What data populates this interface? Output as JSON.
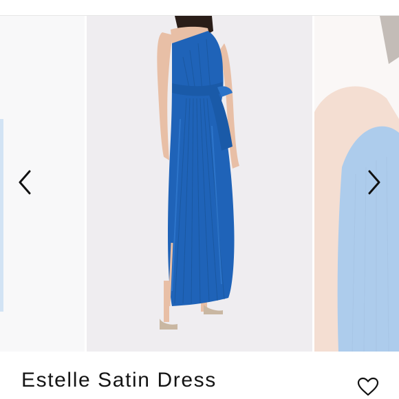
{
  "product": {
    "name": "Estelle Satin Dress",
    "color_hex": "#1f63b8"
  },
  "gallery": {
    "previous_icon": "chevron-left-icon",
    "next_icon": "chevron-right-icon",
    "slides": [
      {
        "role": "previous"
      },
      {
        "role": "current"
      },
      {
        "role": "next"
      }
    ]
  },
  "actions": {
    "favorite_icon": "heart-outline-icon"
  }
}
